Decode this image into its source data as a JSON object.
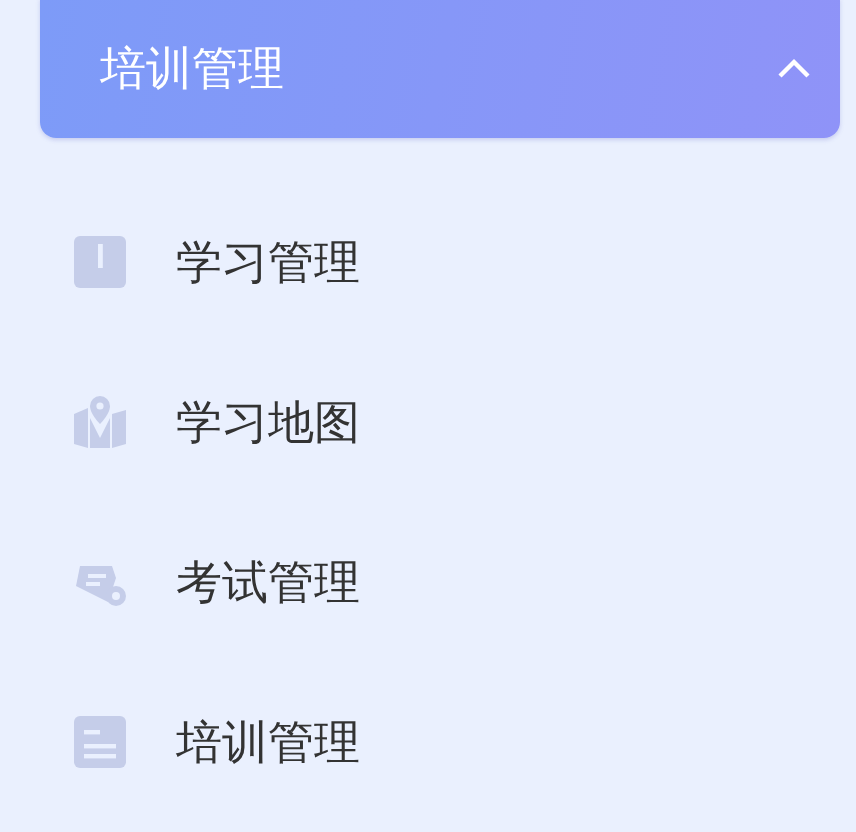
{
  "menu_group": {
    "title": "培训管理",
    "expanded": true
  },
  "items": [
    {
      "label": "学习管理",
      "kind": "book"
    },
    {
      "label": "学习地图",
      "kind": "map"
    },
    {
      "label": "考试管理",
      "kind": "exam"
    },
    {
      "label": "培训管理",
      "kind": "document"
    }
  ]
}
